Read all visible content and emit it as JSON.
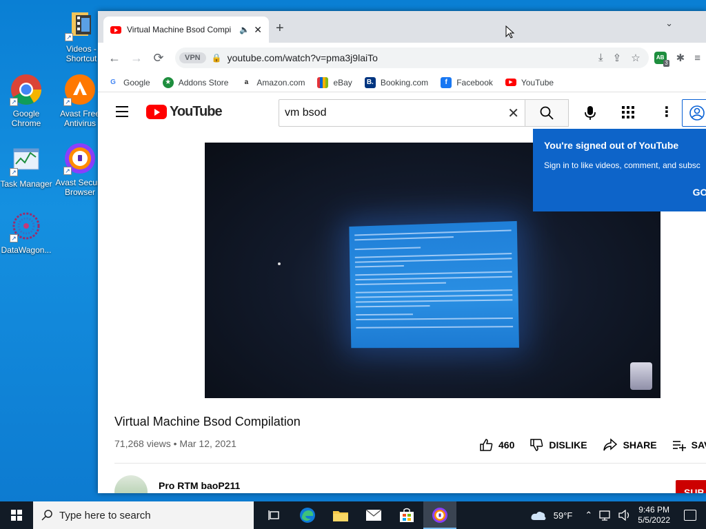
{
  "desktop": {
    "icons": [
      {
        "label": "Videos - Shortcut",
        "name": "videos-shortcut-icon"
      },
      {
        "label": "Google Chrome",
        "name": "google-chrome-icon"
      },
      {
        "label": "Avast Free Antivirus",
        "name": "avast-antivirus-icon"
      },
      {
        "label": "Task Manager",
        "name": "task-manager-icon"
      },
      {
        "label": "Avast Secure Browser",
        "name": "avast-secure-browser-icon"
      },
      {
        "label": "DataWagon...",
        "name": "datawagon-icon"
      }
    ]
  },
  "browser": {
    "tab_title": "Virtual Machine Bsod Compi",
    "url": "youtube.com/watch?v=pma3j9laiTo",
    "vpn_label": "VPN",
    "extension_badge": "3",
    "extension_text": "AB",
    "bookmarks": [
      "Google",
      "Addons Store",
      "Amazon.com",
      "eBay",
      "Booking.com",
      "Facebook",
      "YouTube"
    ]
  },
  "youtube": {
    "logo_text": "YouTube",
    "search_query": "vm bsod",
    "popup": {
      "heading": "You're signed out of YouTube",
      "body": "Sign in to like videos, comment, and subsc",
      "button": "GOT"
    },
    "video_title": "Virtual Machine Bsod Compilation",
    "views": "71,268 views",
    "separator": "•",
    "date": "Mar 12, 2021",
    "likes": "460",
    "dislike_label": "DISLIKE",
    "share_label": "SHARE",
    "save_label": "SAV",
    "channel_name": "Pro RTM baoP211",
    "subscribe_label": "SUB"
  },
  "taskbar": {
    "search_placeholder": "Type here to search",
    "weather": "59°F",
    "time": "9:46 PM",
    "date": "5/5/2022"
  },
  "colors": {
    "youtube_red": "#ff0000",
    "popup_blue": "#0d64c9",
    "desktop_blue": "#0a7fd4",
    "taskbar": "#121b26"
  }
}
